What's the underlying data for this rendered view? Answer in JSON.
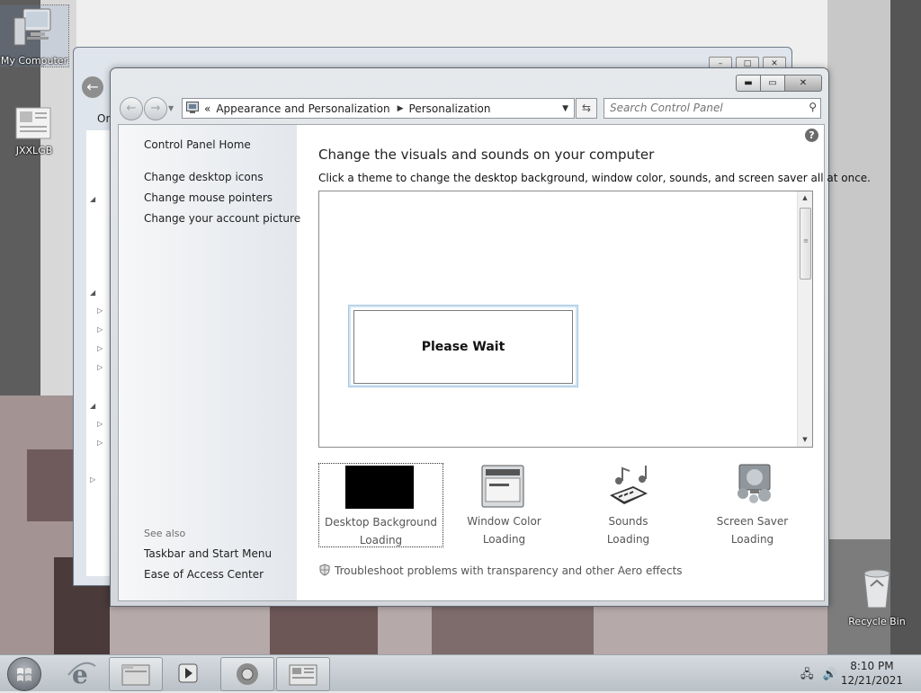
{
  "desktop": {
    "icons": [
      {
        "label": "My Computer",
        "icon": "computer-icon"
      },
      {
        "label": "JXXLGB",
        "icon": "document-icon"
      },
      {
        "label": "Recycle Bin",
        "icon": "recycle-bin-icon"
      }
    ]
  },
  "window": {
    "address": {
      "overflow": "«",
      "crumbs": [
        "Appearance and Personalization",
        "Personalization"
      ]
    },
    "search_placeholder": "Search Control Panel",
    "nav": {
      "home": "Control Panel Home",
      "links": [
        "Change desktop icons",
        "Change mouse pointers",
        "Change your account picture"
      ],
      "see_also_label": "See also",
      "see_also": [
        "Taskbar and Start Menu",
        "Ease of Access Center"
      ]
    },
    "main": {
      "heading": "Change the visuals and sounds on your computer",
      "subheading": "Click a theme to change the desktop background, window color, sounds, and screen saver all at once.",
      "wait_text": "Please Wait",
      "tiles": [
        {
          "label": "Desktop Background",
          "status": "Loading",
          "icon": "desktop-background-icon"
        },
        {
          "label": "Window Color",
          "status": "Loading",
          "icon": "window-color-icon"
        },
        {
          "label": "Sounds",
          "status": "Loading",
          "icon": "sounds-icon"
        },
        {
          "label": "Screen Saver",
          "status": "Loading",
          "icon": "screen-saver-icon"
        }
      ],
      "troubleshoot": "Troubleshoot problems with transparency and other Aero effects"
    }
  },
  "background_window": {
    "toolbar_partial": "Or"
  },
  "taskbar": {
    "clock_time": "8:10 PM",
    "clock_date": "12/21/2021"
  },
  "colors": {
    "window_frame": "#d3d7db",
    "left_nav": "#e3e7ec",
    "wait_border": "#a8c8e2"
  }
}
